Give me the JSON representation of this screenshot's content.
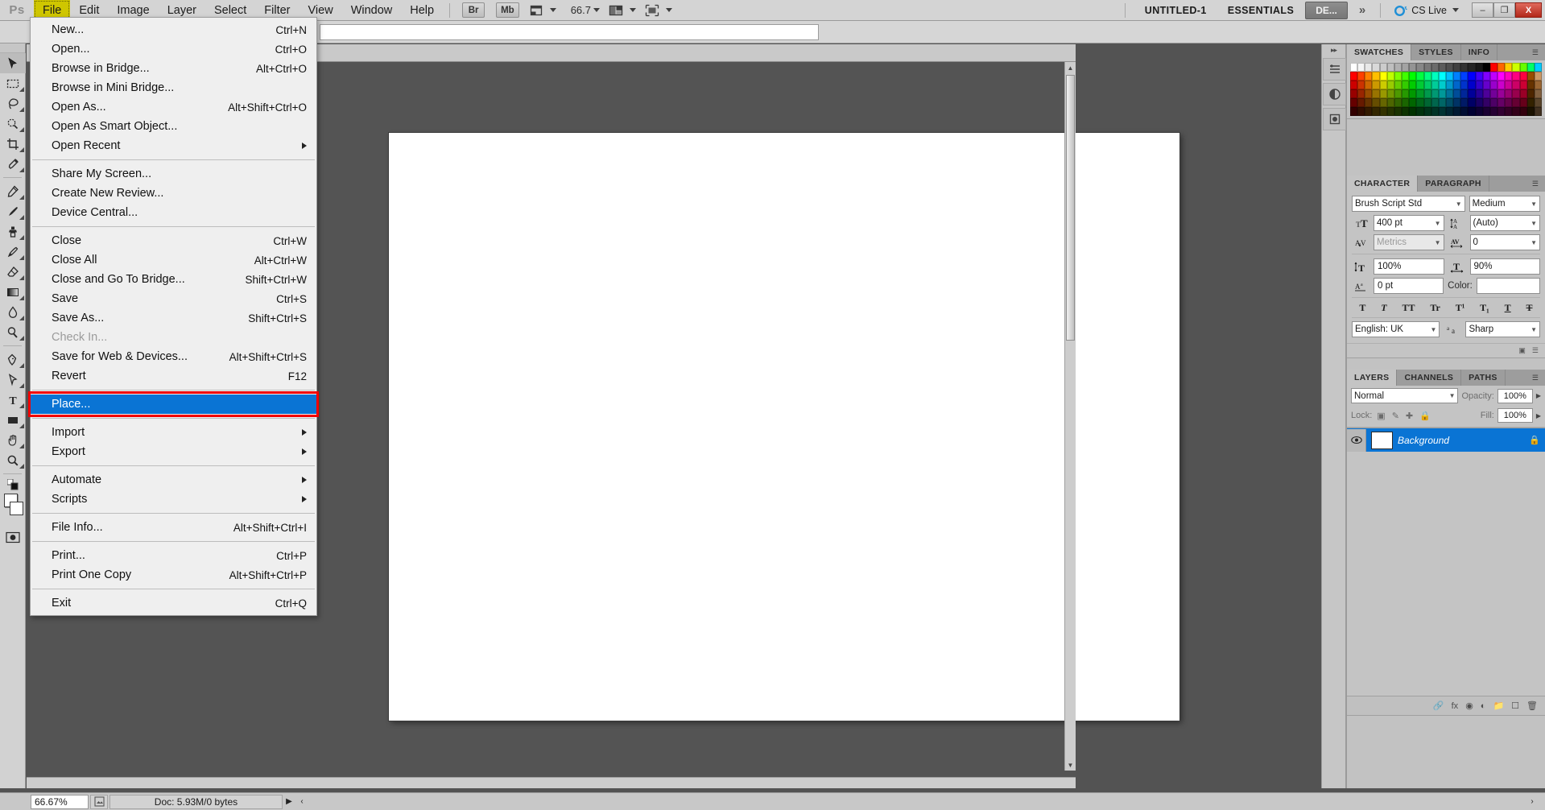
{
  "app": {
    "logo": "Ps",
    "name": "Adobe Photoshop"
  },
  "menubar": {
    "items": [
      {
        "label": "File",
        "active": true
      },
      {
        "label": "Edit",
        "active": false
      },
      {
        "label": "Image",
        "active": false
      },
      {
        "label": "Layer",
        "active": false
      },
      {
        "label": "Select",
        "active": false
      },
      {
        "label": "Filter",
        "active": false
      },
      {
        "label": "View",
        "active": false
      },
      {
        "label": "Window",
        "active": false
      },
      {
        "label": "Help",
        "active": false
      }
    ],
    "bridge_button": "Br",
    "minibridge_button": "Mb",
    "zoom_value": "66.7",
    "document_title": "UNTITLED-1",
    "workspace_name": "ESSENTIALS",
    "workspace_button": "DE...",
    "more_chevron": "»",
    "cs_live": "CS Live",
    "window_minimize": "–",
    "window_restore": "❐",
    "window_close": "X"
  },
  "file_menu": {
    "groups": [
      [
        {
          "label": "New...",
          "shortcut": "Ctrl+N",
          "disabled": false,
          "selected": false,
          "submenu": false
        },
        {
          "label": "Open...",
          "shortcut": "Ctrl+O",
          "disabled": false,
          "selected": false,
          "submenu": false
        },
        {
          "label": "Browse in Bridge...",
          "shortcut": "Alt+Ctrl+O",
          "disabled": false,
          "selected": false,
          "submenu": false
        },
        {
          "label": "Browse in Mini Bridge...",
          "shortcut": "",
          "disabled": false,
          "selected": false,
          "submenu": false
        },
        {
          "label": "Open As...",
          "shortcut": "Alt+Shift+Ctrl+O",
          "disabled": false,
          "selected": false,
          "submenu": false
        },
        {
          "label": "Open As Smart Object...",
          "shortcut": "",
          "disabled": false,
          "selected": false,
          "submenu": false
        },
        {
          "label": "Open Recent",
          "shortcut": "",
          "disabled": false,
          "selected": false,
          "submenu": true
        }
      ],
      [
        {
          "label": "Share My Screen...",
          "shortcut": "",
          "disabled": false,
          "selected": false,
          "submenu": false
        },
        {
          "label": "Create New Review...",
          "shortcut": "",
          "disabled": false,
          "selected": false,
          "submenu": false
        },
        {
          "label": "Device Central...",
          "shortcut": "",
          "disabled": false,
          "selected": false,
          "submenu": false
        }
      ],
      [
        {
          "label": "Close",
          "shortcut": "Ctrl+W",
          "disabled": false,
          "selected": false,
          "submenu": false
        },
        {
          "label": "Close All",
          "shortcut": "Alt+Ctrl+W",
          "disabled": false,
          "selected": false,
          "submenu": false
        },
        {
          "label": "Close and Go To Bridge...",
          "shortcut": "Shift+Ctrl+W",
          "disabled": false,
          "selected": false,
          "submenu": false
        },
        {
          "label": "Save",
          "shortcut": "Ctrl+S",
          "disabled": false,
          "selected": false,
          "submenu": false
        },
        {
          "label": "Save As...",
          "shortcut": "Shift+Ctrl+S",
          "disabled": false,
          "selected": false,
          "submenu": false
        },
        {
          "label": "Check In...",
          "shortcut": "",
          "disabled": true,
          "selected": false,
          "submenu": false
        },
        {
          "label": "Save for Web & Devices...",
          "shortcut": "Alt+Shift+Ctrl+S",
          "disabled": false,
          "selected": false,
          "submenu": false
        },
        {
          "label": "Revert",
          "shortcut": "F12",
          "disabled": false,
          "selected": false,
          "submenu": false
        }
      ],
      [
        {
          "label": "Place...",
          "shortcut": "",
          "disabled": false,
          "selected": true,
          "submenu": false
        }
      ],
      [
        {
          "label": "Import",
          "shortcut": "",
          "disabled": false,
          "selected": false,
          "submenu": true
        },
        {
          "label": "Export",
          "shortcut": "",
          "disabled": false,
          "selected": false,
          "submenu": true
        }
      ],
      [
        {
          "label": "Automate",
          "shortcut": "",
          "disabled": false,
          "selected": false,
          "submenu": true
        },
        {
          "label": "Scripts",
          "shortcut": "",
          "disabled": false,
          "selected": false,
          "submenu": true
        }
      ],
      [
        {
          "label": "File Info...",
          "shortcut": "Alt+Shift+Ctrl+I",
          "disabled": false,
          "selected": false,
          "submenu": false
        }
      ],
      [
        {
          "label": "Print...",
          "shortcut": "Ctrl+P",
          "disabled": false,
          "selected": false,
          "submenu": false
        },
        {
          "label": "Print One Copy",
          "shortcut": "Alt+Shift+Ctrl+P",
          "disabled": false,
          "selected": false,
          "submenu": false
        }
      ],
      [
        {
          "label": "Exit",
          "shortcut": "Ctrl+Q",
          "disabled": false,
          "selected": false,
          "submenu": false
        }
      ]
    ],
    "highlight_color": "#0a74d4",
    "annotation_color": "#f20000"
  },
  "toolbar": {
    "tools": [
      {
        "name": "move-tool",
        "selected": true
      },
      {
        "name": "marquee-tool",
        "selected": false
      },
      {
        "name": "lasso-tool",
        "selected": false
      },
      {
        "name": "quick-selection-tool",
        "selected": false
      },
      {
        "name": "crop-tool",
        "selected": false
      },
      {
        "name": "eyedropper-tool",
        "selected": false
      },
      {
        "name": "spot-healing-brush-tool",
        "selected": false
      },
      {
        "name": "brush-tool",
        "selected": false
      },
      {
        "name": "clone-stamp-tool",
        "selected": false
      },
      {
        "name": "history-brush-tool",
        "selected": false
      },
      {
        "name": "eraser-tool",
        "selected": false
      },
      {
        "name": "gradient-tool",
        "selected": false
      },
      {
        "name": "blur-tool",
        "selected": false
      },
      {
        "name": "dodge-tool",
        "selected": false
      },
      {
        "name": "pen-tool",
        "selected": false
      },
      {
        "name": "path-selection-tool",
        "selected": false
      },
      {
        "name": "type-tool",
        "selected": false
      },
      {
        "name": "rectangle-tool",
        "selected": false
      },
      {
        "name": "hand-tool",
        "selected": false
      },
      {
        "name": "zoom-tool",
        "selected": false
      }
    ],
    "foreground_color": "#ffffff",
    "background_color": "#ffffff"
  },
  "statusbar": {
    "zoom": "66.67%",
    "doc_info": "Doc: 5.93M/0 bytes",
    "expand_arrow": "▶",
    "prev_arrow": "‹"
  },
  "panels": {
    "swatches": {
      "tabs": [
        {
          "label": "SWATCHES",
          "active": true
        },
        {
          "label": "STYLES",
          "active": false
        },
        {
          "label": "INFO",
          "active": false
        }
      ],
      "colors": [
        "#ffffff",
        "#f5f5f5",
        "#e8e8e8",
        "#d9d9d9",
        "#cccccc",
        "#bfbfbf",
        "#b0b0b0",
        "#a3a3a3",
        "#949494",
        "#878787",
        "#787878",
        "#6b6b6b",
        "#5c5c5c",
        "#4f4f4f",
        "#404040",
        "#333333",
        "#242424",
        "#171717",
        "#000000",
        "#ff0000",
        "#ff6600",
        "#ffcc00",
        "#ccff00",
        "#66ff00",
        "#00ff66",
        "#00ccff",
        "#ff0000",
        "#ff4000",
        "#ff8000",
        "#ffbf00",
        "#ffff00",
        "#bfff00",
        "#80ff00",
        "#40ff00",
        "#00ff00",
        "#00ff40",
        "#00ff80",
        "#00ffbf",
        "#00ffff",
        "#00bfff",
        "#0080ff",
        "#0040ff",
        "#0000ff",
        "#4000ff",
        "#8000ff",
        "#bf00ff",
        "#ff00ff",
        "#ff00bf",
        "#ff0080",
        "#ff0040",
        "#994d00",
        "#cc9966",
        "#cc0000",
        "#cc3300",
        "#cc6600",
        "#cc9900",
        "#cccc00",
        "#99cc00",
        "#66cc00",
        "#33cc00",
        "#00cc00",
        "#00cc33",
        "#00cc66",
        "#00cc99",
        "#00cccc",
        "#0099cc",
        "#0066cc",
        "#0033cc",
        "#0000cc",
        "#3300cc",
        "#6600cc",
        "#9900cc",
        "#cc00cc",
        "#cc0099",
        "#cc0066",
        "#cc0033",
        "#663300",
        "#996633",
        "#990000",
        "#992600",
        "#994d00",
        "#997300",
        "#999900",
        "#739900",
        "#4d9900",
        "#269900",
        "#009900",
        "#009926",
        "#00994d",
        "#009973",
        "#009999",
        "#007399",
        "#004d99",
        "#002699",
        "#000099",
        "#260099",
        "#4d0099",
        "#730099",
        "#990099",
        "#990073",
        "#99004d",
        "#990026",
        "#4d2600",
        "#806040",
        "#660000",
        "#661a00",
        "#663300",
        "#664d00",
        "#666600",
        "#4d6600",
        "#336600",
        "#1a6600",
        "#006600",
        "#00661a",
        "#006633",
        "#00664d",
        "#006666",
        "#004d66",
        "#003366",
        "#001a66",
        "#000066",
        "#1a0066",
        "#330066",
        "#4d0066",
        "#660066",
        "#66004d",
        "#660033",
        "#66001a",
        "#332200",
        "#59442b",
        "#330000",
        "#330d00",
        "#331a00",
        "#332600",
        "#333300",
        "#263300",
        "#1a3300",
        "#0d3300",
        "#003300",
        "#00330d",
        "#00331a",
        "#003326",
        "#003333",
        "#002633",
        "#001a33",
        "#000d33",
        "#000033",
        "#0d0033",
        "#1a0033",
        "#260033",
        "#330033",
        "#330026",
        "#33001a",
        "#33000d",
        "#1a1100",
        "#403020"
      ]
    },
    "character": {
      "tabs": [
        {
          "label": "CHARACTER",
          "active": true
        },
        {
          "label": "PARAGRAPH",
          "active": false
        }
      ],
      "font_family": "Brush Script Std",
      "font_style": "Medium",
      "font_size": "400 pt",
      "leading": "(Auto)",
      "kerning": "Metrics",
      "tracking": "0",
      "vertical_scale": "100%",
      "horizontal_scale": "90%",
      "baseline_shift": "0 pt",
      "color_label": "Color:",
      "color_value": "#ffffff",
      "language": "English: UK",
      "antialias": "Sharp",
      "style_buttons": [
        "T",
        "T",
        "TT",
        "Tr",
        "T¹",
        "T₁",
        "T",
        "T"
      ]
    },
    "layers": {
      "tabs": [
        {
          "label": "LAYERS",
          "active": true
        },
        {
          "label": "CHANNELS",
          "active": false
        },
        {
          "label": "PATHS",
          "active": false
        }
      ],
      "blend_mode": "Normal",
      "opacity_label": "Opacity:",
      "opacity_value": "100%",
      "lock_label": "Lock:",
      "fill_label": "Fill:",
      "fill_value": "100%",
      "items": [
        {
          "name": "Background",
          "visible": true,
          "locked": true,
          "selected": true
        }
      ]
    }
  }
}
